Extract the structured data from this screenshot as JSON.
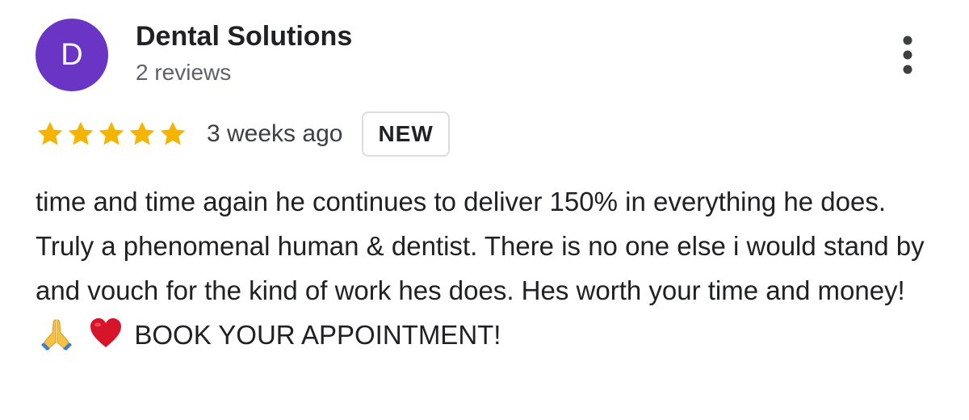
{
  "colors": {
    "avatar_bg": "#6a35c4",
    "star": "#f5b400",
    "heart": "#d7142a"
  },
  "review": {
    "author": {
      "avatar_letter": "D",
      "name": "Dental Solutions",
      "review_count": "2 reviews"
    },
    "menu_icon": "more-vertical-icon",
    "rating": 5,
    "time_ago": "3 weeks ago",
    "badge": "NEW",
    "text_part1": "time and time again he continues to deliver 150% in everything he does. Truly a phenomenal human & dentist. There is no one else i would stand by and vouch for the kind of work hes does. Hes worth your time and money!",
    "emojis": [
      "folded-hands-icon",
      "red-heart-icon"
    ],
    "text_part2": "BOOK YOUR APPOINTMENT!"
  }
}
